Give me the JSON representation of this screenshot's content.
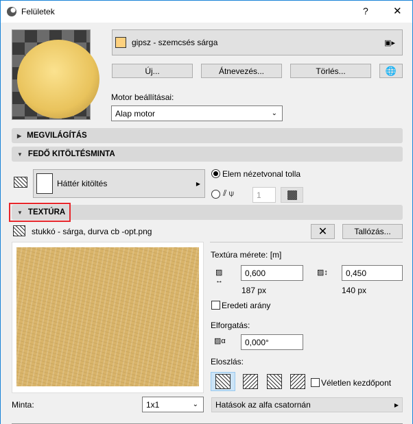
{
  "window": {
    "title": "Felületek",
    "help_label": "?",
    "close_label": "✕"
  },
  "material": {
    "name": "gipsz - szemcsés sárga",
    "color": "#fdd17f",
    "new_label": "Új...",
    "rename_label": "Átnevezés...",
    "delete_label": "Törlés...",
    "engine_label": "Motor beállításai:",
    "engine_value": "Alap motor"
  },
  "sections": {
    "lighting": "MEGVILÁGÍTÁS",
    "cover_fill": "FEDŐ KITÖLTÉSMINTA",
    "texture": "TEXTÚRA"
  },
  "cover_fill": {
    "fill_label": "Háttér kitöltés",
    "radio_pen_label": "Elem nézetvonal tolla",
    "pen_value": "1"
  },
  "texture": {
    "file_name": "stukkó - sárga, durva cb -opt.png",
    "browse_label": "Tallózás...",
    "size_label": "Textúra mérete: [m]",
    "width_value": "0,600",
    "height_value": "0,450",
    "width_px": "187 px",
    "height_px": "140 px",
    "keep_ratio_label": "Eredeti arány",
    "rotation_label": "Elforgatás:",
    "rotation_value": "0,000°",
    "distribution_label": "Eloszlás:",
    "random_origin_label": "Véletlen kezdőpont",
    "pattern_label": "Minta:",
    "pattern_value": "1x1",
    "alpha_label": "Hatások az alfa csatornán"
  }
}
